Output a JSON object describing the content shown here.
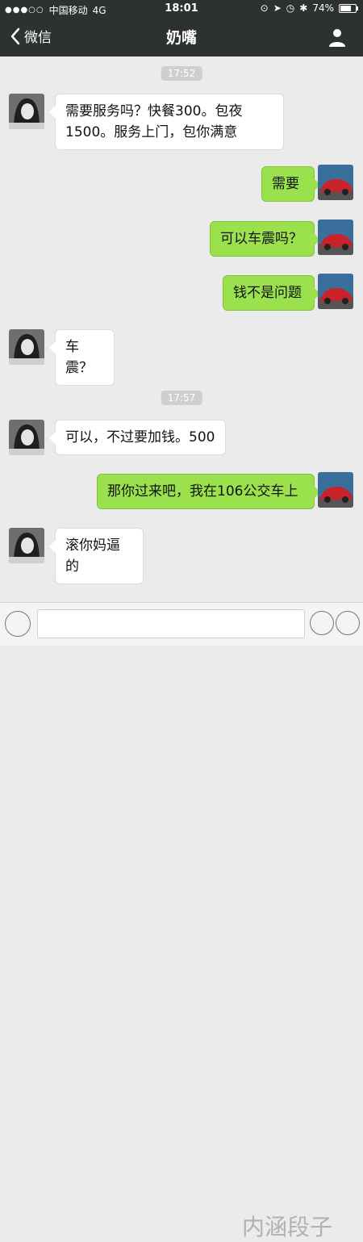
{
  "status_bar": {
    "signal": "●●●○○",
    "carrier": "中国移动",
    "network": "4G",
    "time": "18:01",
    "battery_percent": "74%",
    "battery_level": 0.74
  },
  "header": {
    "back_label": "微信",
    "title": "奶嘴"
  },
  "messages": [
    {
      "type": "timestamp",
      "text": "17:52"
    },
    {
      "type": "in",
      "text": "需要服务吗？快餐300。包夜1500。服务上门，包你满意"
    },
    {
      "type": "out",
      "text": "需要"
    },
    {
      "type": "out",
      "text": "可以车震吗？"
    },
    {
      "type": "out",
      "text": "钱不是问题"
    },
    {
      "type": "in",
      "text": "车震？"
    },
    {
      "type": "timestamp",
      "text": "17:57"
    },
    {
      "type": "in",
      "text": "可以，不过要加钱。500"
    },
    {
      "type": "out",
      "text": "那你过来吧，我在106公交车上"
    },
    {
      "type": "in",
      "text": "滚你妈逼的"
    }
  ],
  "input_bar": {
    "watermark": "内涵段子"
  }
}
